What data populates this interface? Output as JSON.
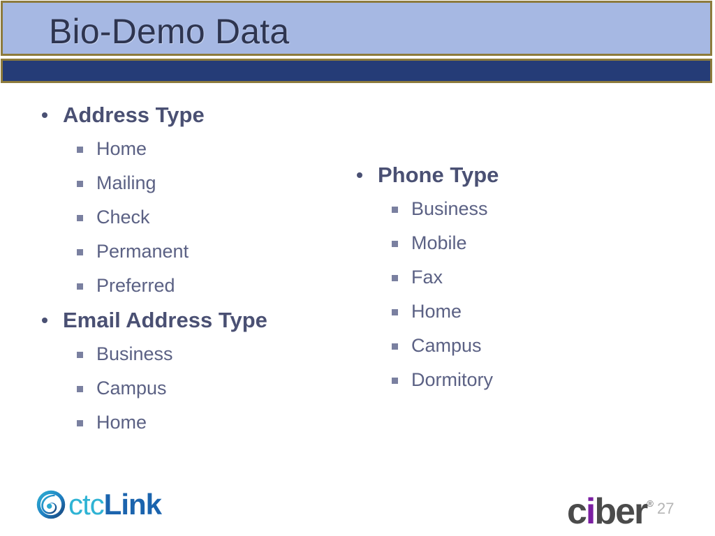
{
  "slide": {
    "title": "Bio-Demo Data",
    "slide_number": "27",
    "background_color": "#ffffff",
    "banner_color": "#a6b8e3",
    "banner_border_color": "#8d7b3c",
    "navy_bar_color": "#253c77",
    "title_color": "#2e3550",
    "heading_color": "#4a5073",
    "subitem_color": "#5b6184"
  },
  "content": {
    "left_column": [
      {
        "heading": "Address Type",
        "items": [
          "Home",
          "Mailing",
          "Check",
          "Permanent",
          "Preferred"
        ]
      },
      {
        "heading": "Email Address Type",
        "items": [
          "Business",
          "Campus",
          "Home"
        ]
      }
    ],
    "right_column": [
      {
        "heading": "Phone Type",
        "items": [
          "Business",
          "Mobile",
          "Fax",
          "Home",
          "Campus",
          "Dormitory"
        ]
      }
    ]
  },
  "logos": {
    "ctclink": {
      "icon": "swirl-icon",
      "text_part1": "ctc",
      "text_part2": "Link",
      "color_part1": "#2fb3d4",
      "color_part2": "#1b64ae"
    },
    "ciber": {
      "text_before_i": "c",
      "text_i": "i",
      "text_after_i": "ber",
      "registered_mark": "®",
      "color": "#4b4b4b",
      "accent_color": "#7b1fa2"
    }
  }
}
